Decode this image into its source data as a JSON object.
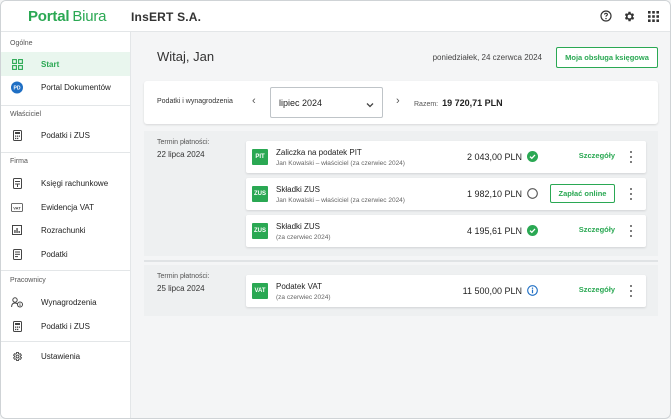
{
  "header": {
    "brand_primary": "Portal",
    "brand_secondary": "Biura",
    "company": "InsERT S.A.",
    "icons": [
      "help-icon",
      "gear-icon",
      "apps-grid-icon"
    ]
  },
  "colors": {
    "accent": "#2aa853",
    "active_bg": "#e9f6ee"
  },
  "sidebar": {
    "sections": [
      {
        "title": "Ogólne",
        "items": [
          {
            "label": "Start",
            "icon": "dashboard-icon",
            "active": true
          },
          {
            "label": "Portal Dokumentów",
            "icon": "pd-badge-icon",
            "active": false
          }
        ]
      },
      {
        "title": "Właściciel",
        "items": [
          {
            "label": "Podatki i ZUS",
            "icon": "calculator-icon"
          }
        ]
      },
      {
        "title": "Firma",
        "items": [
          {
            "label": "Księgi rachunkowe",
            "icon": "ledger-icon"
          },
          {
            "label": "Ewidencja VAT",
            "icon": "vat-icon"
          },
          {
            "label": "Rozrachunki",
            "icon": "chart-icon"
          },
          {
            "label": "Podatki",
            "icon": "tax-doc-icon"
          }
        ]
      },
      {
        "title": "Pracownicy",
        "items": [
          {
            "label": "Wynagrodzenia",
            "icon": "people-icon"
          },
          {
            "label": "Podatki i ZUS",
            "icon": "calculator-icon"
          }
        ]
      },
      {
        "title": "",
        "items": [
          {
            "label": "Ustawienia",
            "icon": "gear-icon"
          }
        ]
      }
    ]
  },
  "main": {
    "greeting": "Witaj, Jan",
    "date": "poniedziałek, 24 czerwca 2024",
    "service_button": "Moja obsługa księgowa",
    "filter": {
      "label": "Podatki i wynagrodzenia",
      "period": "lipiec 2024",
      "total_label": "Razem:",
      "total_value": "19 720,71 PLN"
    },
    "groups": [
      {
        "term_label": "Termin płatności:",
        "term_date": "22 lipca 2024",
        "rows": [
          {
            "badge": "PIT",
            "title": "Zaliczka na podatek PIT",
            "subtitle": "Jan Kowalski – właściciel (za czerwiec 2024)",
            "amount": "2 043,00 PLN",
            "status": "paid",
            "action": "Szczegóły"
          },
          {
            "badge": "ZUS",
            "title": "Składki ZUS",
            "subtitle": "Jan Kowalski – właściciel (za czerwiec 2024)",
            "amount": "1 982,10 PLN",
            "status": "unpaid",
            "action": "Zapłać online"
          },
          {
            "badge": "ZUS",
            "title": "Składki ZUS",
            "subtitle": "(za czerwiec 2024)",
            "amount": "4 195,61 PLN",
            "status": "paid",
            "action": "Szczegóły"
          }
        ]
      },
      {
        "term_label": "Termin płatności:",
        "term_date": "25 lipca 2024",
        "rows": [
          {
            "badge": "VAT",
            "title": "Podatek VAT",
            "subtitle": "(za czerwiec 2024)",
            "amount": "11 500,00 PLN",
            "status": "info",
            "action": "Szczegóły"
          }
        ]
      }
    ]
  }
}
